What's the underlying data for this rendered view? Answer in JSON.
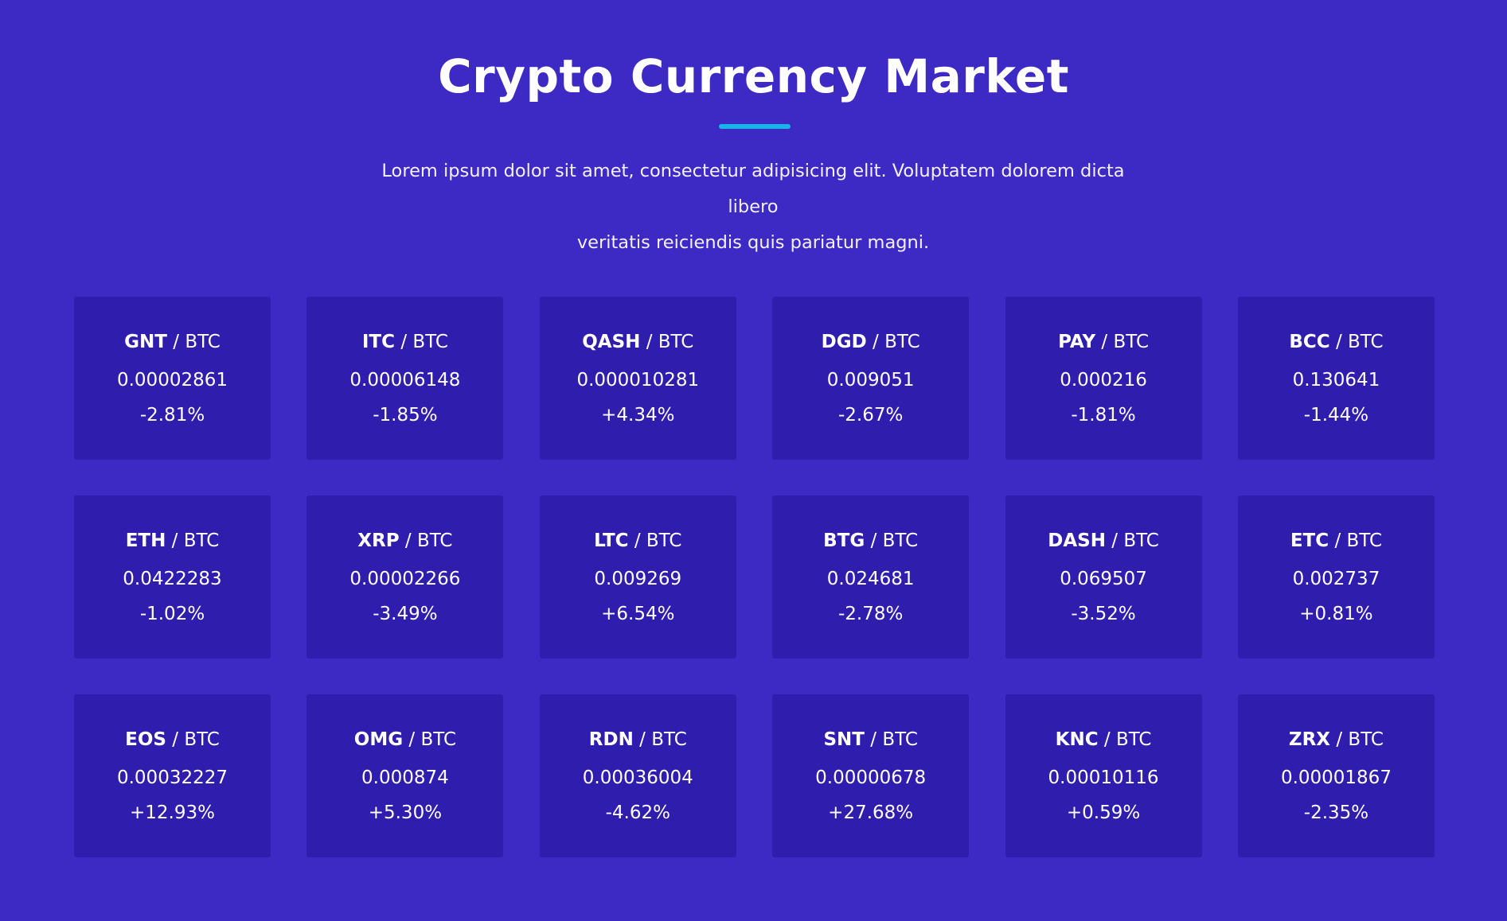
{
  "header": {
    "title": "Crypto Currency Market",
    "subtitle_line1": "Lorem ipsum dolor sit amet, consectetur adipisicing elit. Voluptatem dolorem dicta libero",
    "subtitle_line2": "veritatis reiciendis quis pariatur magni."
  },
  "colors": {
    "background": "#3d2ac4",
    "card": "#2f1eae",
    "accent": "#19b5e6",
    "text": "#ffffff"
  },
  "separator": "/",
  "quote": "BTC",
  "markets": [
    {
      "base": "GNT",
      "price": "0.00002861",
      "change": "-2.81%"
    },
    {
      "base": "ITC",
      "price": "0.00006148",
      "change": "-1.85%"
    },
    {
      "base": "QASH",
      "price": "0.000010281",
      "change": "+4.34%"
    },
    {
      "base": "DGD",
      "price": "0.009051",
      "change": "-2.67%"
    },
    {
      "base": "PAY",
      "price": "0.000216",
      "change": "-1.81%"
    },
    {
      "base": "BCC",
      "price": "0.130641",
      "change": "-1.44%"
    },
    {
      "base": "ETH",
      "price": "0.0422283",
      "change": "-1.02%"
    },
    {
      "base": "XRP",
      "price": "0.00002266",
      "change": "-3.49%"
    },
    {
      "base": "LTC",
      "price": "0.009269",
      "change": "+6.54%"
    },
    {
      "base": "BTG",
      "price": "0.024681",
      "change": "-2.78%"
    },
    {
      "base": "DASH",
      "price": "0.069507",
      "change": "-3.52%"
    },
    {
      "base": "ETC",
      "price": "0.002737",
      "change": "+0.81%"
    },
    {
      "base": "EOS",
      "price": "0.00032227",
      "change": "+12.93%"
    },
    {
      "base": "OMG",
      "price": "0.000874",
      "change": "+5.30%"
    },
    {
      "base": "RDN",
      "price": "0.00036004",
      "change": "-4.62%"
    },
    {
      "base": "SNT",
      "price": "0.00000678",
      "change": "+27.68%"
    },
    {
      "base": "KNC",
      "price": "0.00010116",
      "change": "+0.59%"
    },
    {
      "base": "ZRX",
      "price": "0.00001867",
      "change": "-2.35%"
    }
  ]
}
